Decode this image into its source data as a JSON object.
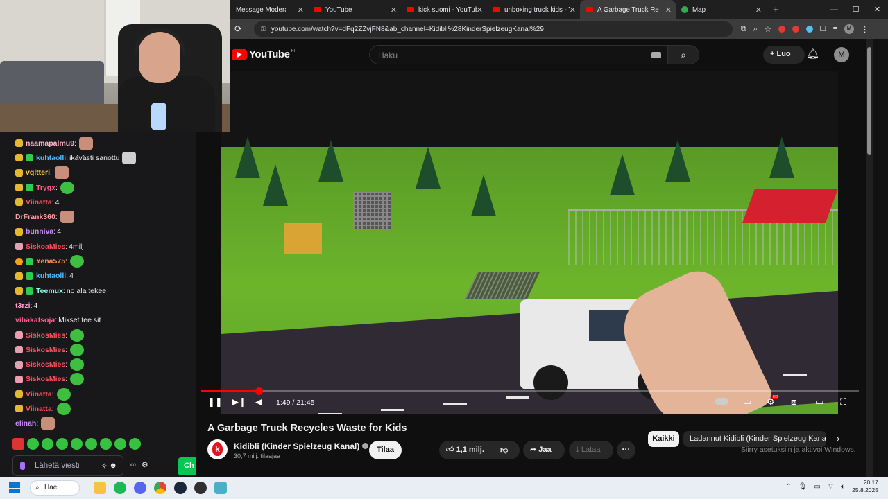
{
  "chat": {
    "lines": [
      {
        "badges": [
          "gold"
        ],
        "name": "naamapalmu9",
        "color": "#ffb3c8",
        "msg": "",
        "emote": "face"
      },
      {
        "badges": [
          "gold",
          "green"
        ],
        "name": "kuhtaolli",
        "color": "#4fb7ff",
        "msg": "ikävästi sanottu",
        "emote": "cat"
      },
      {
        "badges": [
          "gold"
        ],
        "name": "vqltteri",
        "color": "#ffd24d",
        "msg": "",
        "emote": "face"
      },
      {
        "badges": [
          "gold",
          "green"
        ],
        "name": "Trygx",
        "color": "#ff5c8a",
        "msg": "",
        "emote": "frog"
      },
      {
        "badges": [
          "gold"
        ],
        "name": "Viinatta",
        "color": "#ff4f5e",
        "msg": "4",
        "emote": ""
      },
      {
        "badges": [],
        "name": "DrFrank360",
        "color": "#ff9f9f",
        "msg": "",
        "emote": "face"
      },
      {
        "badges": [
          "gold"
        ],
        "name": "bunniva",
        "color": "#c98bff",
        "msg": "4",
        "emote": ""
      },
      {
        "badges": [
          "pink"
        ],
        "name": "SiskoaMies",
        "color": "#ff4f5e",
        "msg": "4milj",
        "emote": ""
      },
      {
        "badges": [
          "orange",
          "green"
        ],
        "name": "Yena575",
        "color": "#ff8c4f",
        "msg": "",
        "emote": "frog"
      },
      {
        "badges": [
          "gold",
          "green"
        ],
        "name": "kuhtaolli",
        "color": "#4fb7ff",
        "msg": "4",
        "emote": ""
      },
      {
        "badges": [
          "gold",
          "green"
        ],
        "name": "Teemux",
        "color": "#8effe0",
        "msg": "no ala tekee",
        "emote": ""
      },
      {
        "badges": [],
        "name": "t3rzi",
        "color": "#ff9fd0",
        "msg": "4",
        "emote": ""
      },
      {
        "badges": [],
        "name": "vihakatsoja",
        "color": "#ff5c8a",
        "msg": "Mikset tee sit",
        "emote": ""
      },
      {
        "badges": [
          "pink"
        ],
        "name": "SiskosMies",
        "color": "#ff4f5e",
        "msg": "",
        "emote": "frog"
      },
      {
        "badges": [
          "pink"
        ],
        "name": "SiskosMies",
        "color": "#ff4f5e",
        "msg": "",
        "emote": "frog"
      },
      {
        "badges": [
          "pink"
        ],
        "name": "SiskosMies",
        "color": "#ff4f5e",
        "msg": "",
        "emote": "frog"
      },
      {
        "badges": [
          "pink"
        ],
        "name": "SiskosMies",
        "color": "#ff4f5e",
        "msg": "",
        "emote": "frog"
      },
      {
        "badges": [
          "gold"
        ],
        "name": "Viinatta",
        "color": "#ff4f5e",
        "msg": "",
        "emote": "frog"
      },
      {
        "badges": [
          "gold"
        ],
        "name": "Viinatta",
        "color": "#ff4f5e",
        "msg": "",
        "emote": "frog"
      },
      {
        "badges": [],
        "name": "elinah",
        "color": "#c98bff",
        "msg": "",
        "emote": "face"
      }
    ],
    "input_placeholder": "Lähetä viesti",
    "send_label": "Ch",
    "infinity": "∞"
  },
  "browser": {
    "tabs": [
      {
        "title": "Message Moderation - I",
        "active": false,
        "fav": "yt"
      },
      {
        "title": "YouTube",
        "active": false,
        "fav": "yt"
      },
      {
        "title": "kick suomi - YouTube",
        "active": false,
        "fav": "yt"
      },
      {
        "title": "unboxing truck kids - Yo",
        "active": false,
        "fav": "yt"
      },
      {
        "title": "A Garbage Truck Re",
        "active": true,
        "fav": "yt"
      },
      {
        "title": "Map",
        "active": false,
        "fav": "map"
      }
    ],
    "url": "youtube.com/watch?v=dFq2ZZvjFN8&ab_channel=Kidibli%28KinderSpielzeugKanal%29",
    "profile_initial": "M"
  },
  "youtube": {
    "logo_text": "YouTube",
    "country_code": "FI",
    "search_placeholder": "Haku",
    "create_label": "Luo",
    "avatar_initial": "M",
    "player": {
      "time": "1:49 / 21:45",
      "progress_fraction": 0.088
    },
    "video_title": "A Garbage Truck Recycles Waste for Kids",
    "channel_name": "Kidibli (Kinder Spielzeug Kanal)",
    "subscribers": "30,7 milj. tilaajaa",
    "subscribe_label": "Tilaa",
    "likes": "1,1 milj.",
    "share_label": "Jaa",
    "download_label": "Lataa",
    "chip_all": "Kaikki",
    "chip_uploads": "Ladannut Kidibli (Kinder Spielzeug Kanal)",
    "activate_windows": "Siirry asetuksiin ja aktivoi Windows."
  },
  "taskbar": {
    "search_label": "Hae",
    "time": "20.17",
    "date": "25.8.2025"
  },
  "colors": {
    "youtube_red": "#ff0000",
    "chat_bg": "#18181b",
    "kick_green": "#00c853"
  }
}
